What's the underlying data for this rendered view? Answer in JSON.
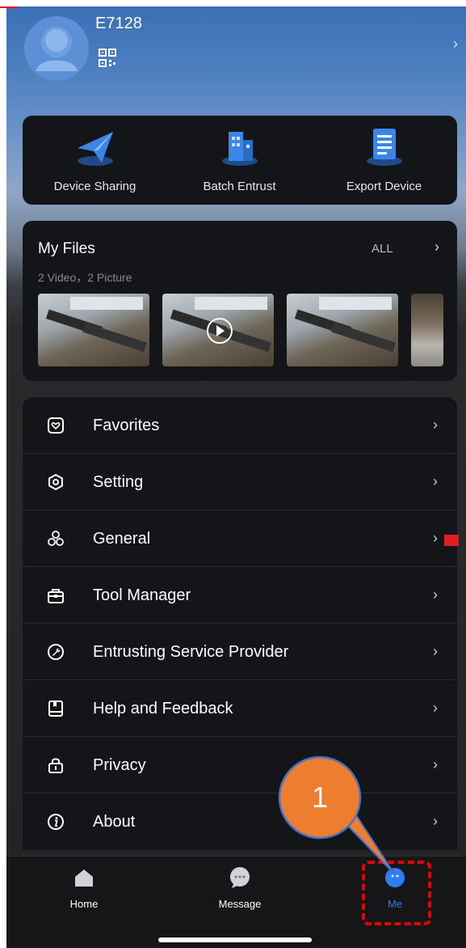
{
  "profile": {
    "username": "E7128"
  },
  "actions": [
    {
      "label": "Device Sharing",
      "icon": "paper-plane-icon"
    },
    {
      "label": "Batch Entrust",
      "icon": "building-icon"
    },
    {
      "label": "Export Device",
      "icon": "document-list-icon"
    }
  ],
  "files": {
    "title": "My Files",
    "all_label": "ALL",
    "summary": "2 Video，2 Picture"
  },
  "menu": [
    {
      "label": "Favorites",
      "icon": "heart-box-icon"
    },
    {
      "label": "Setting",
      "icon": "hexagon-gear-icon"
    },
    {
      "label": "General",
      "icon": "circles-icon"
    },
    {
      "label": "Tool Manager",
      "icon": "toolbox-icon"
    },
    {
      "label": "Entrusting Service Provider",
      "icon": "wrench-circle-icon"
    },
    {
      "label": "Help and Feedback",
      "icon": "book-icon"
    },
    {
      "label": "Privacy",
      "icon": "lock-icon"
    },
    {
      "label": "About",
      "icon": "info-icon"
    }
  ],
  "tabs": [
    {
      "label": "Home",
      "icon": "home-icon",
      "active": false
    },
    {
      "label": "Message",
      "icon": "message-icon",
      "active": false
    },
    {
      "label": "Me",
      "icon": "me-icon",
      "active": true
    }
  ],
  "annotation": {
    "number": "1"
  },
  "colors": {
    "accent": "#2f7cf6",
    "annotation_fill": "#ed7d31",
    "annotation_border": "#4472c4",
    "highlight": "#e60000"
  }
}
